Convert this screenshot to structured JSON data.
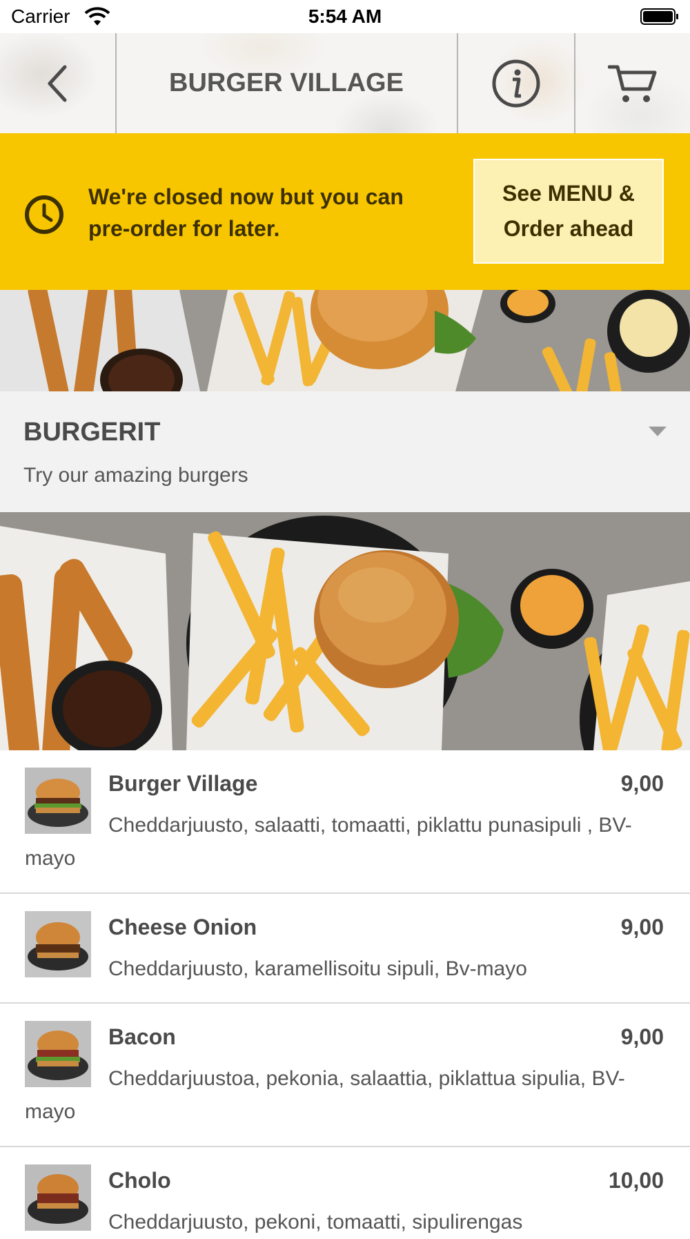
{
  "status_bar": {
    "carrier": "Carrier",
    "time": "5:54 AM"
  },
  "header": {
    "title": "BURGER VILLAGE",
    "back_icon": "chevron-left-icon",
    "info_icon": "info-circle-icon",
    "cart_icon": "cart-icon"
  },
  "banner": {
    "message": "We're closed now but you can pre-order for later.",
    "button_label": "See MENU & Order ahead",
    "icon": "clock-icon",
    "color": "#f8c600"
  },
  "category": {
    "title": "BURGERIT",
    "subtitle": "Try our amazing burgers"
  },
  "items": [
    {
      "name": "Burger Village",
      "price": "9,00",
      "description": "Cheddarjuusto, salaatti, tomaatti, piklattu punasipuli , BV-mayo"
    },
    {
      "name": "Cheese Onion",
      "price": "9,00",
      "description": "Cheddarjuusto, karamellisoitu sipuli, Bv-mayo"
    },
    {
      "name": "Bacon",
      "price": "9,00",
      "description": "Cheddarjuustoa, pekonia, salaattia, piklattua sipulia, BV-mayo"
    },
    {
      "name": "Cholo",
      "price": "10,00",
      "description": "Cheddarjuusto, pekoni, tomaatti, sipulirengas"
    }
  ]
}
